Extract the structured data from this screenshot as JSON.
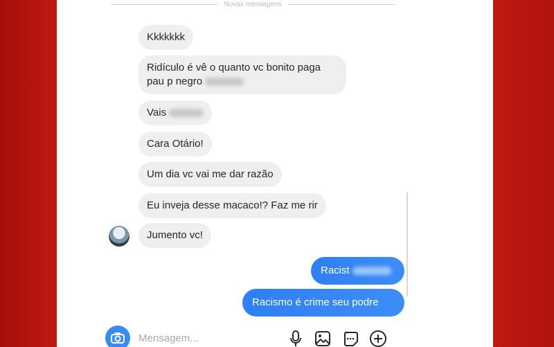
{
  "divider": {
    "text": "Novas mensagens"
  },
  "incoming": [
    {
      "text": "Kkkkkkk"
    },
    {
      "line1": "Ridículo é vê o quanto vc bonito paga",
      "line2": "pau p negro"
    },
    {
      "text": "Vais"
    },
    {
      "text": "Cara Otário!"
    },
    {
      "text": "Um dia vc vai me dar razão"
    },
    {
      "text": "Eu inveja desse macaco!? Faz me rir"
    },
    {
      "text": "Jumento vc!"
    }
  ],
  "outgoing": [
    {
      "text": "Racist"
    },
    {
      "text": "Racismo é crime seu podre"
    }
  ],
  "composer": {
    "placeholder": "Mensagem...",
    "icons": [
      "camera-icon",
      "microphone-icon",
      "gallery-icon",
      "sticker-icon",
      "add-icon"
    ]
  },
  "colors": {
    "frame": "#b5140f",
    "outgoing_bubble": "#3a8cf5",
    "incoming_bubble": "#efefef"
  }
}
